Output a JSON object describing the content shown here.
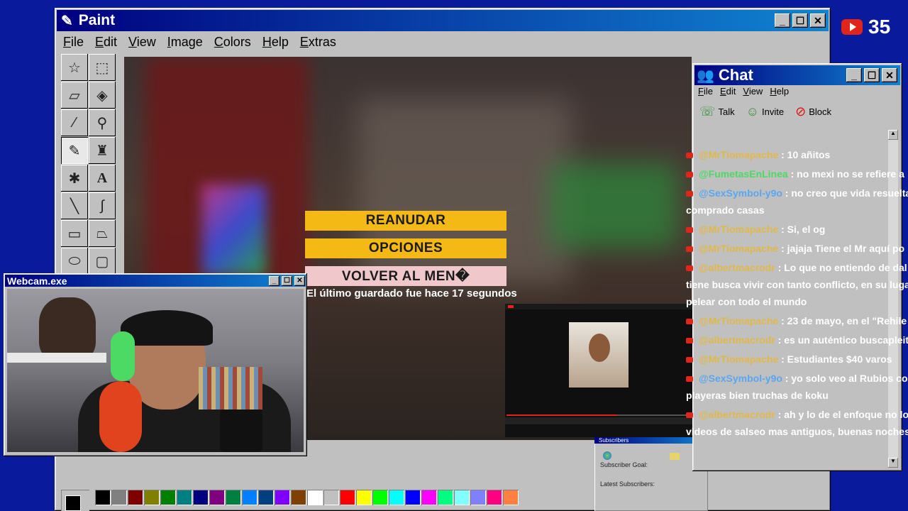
{
  "youtube_counter": {
    "count": "35"
  },
  "paint": {
    "title": "Paint",
    "menu": [
      "File",
      "Edit",
      "View",
      "Image",
      "Colors",
      "Help",
      "Extras"
    ],
    "tools": [
      "free-select-icon",
      "rect-select-icon",
      "eraser-icon",
      "fill-bucket-icon",
      "color-picker-icon",
      "magnifier-icon",
      "pencil-icon",
      "brush-icon",
      "airbrush-icon",
      "text-icon",
      "line-icon",
      "curve-icon",
      "rectangle-icon",
      "polygon-icon",
      "ellipse-icon",
      "rounded-rect-icon"
    ],
    "palette": [
      "#000000",
      "#808080",
      "#800000",
      "#808000",
      "#008000",
      "#008080",
      "#000080",
      "#800080",
      "#008040",
      "#0080ff",
      "#004080",
      "#8000ff",
      "#804000",
      "#ffffff",
      "#c0c0c0",
      "#ff0000",
      "#ffff00",
      "#00ff00",
      "#00ffff",
      "#0000ff",
      "#ff00ff",
      "#00ff80",
      "#80ffff",
      "#8080ff",
      "#ff0080",
      "#ff8040"
    ]
  },
  "game_menu": {
    "resume": "REANUDAR",
    "options": "OPCIONES",
    "main_menu": "VOLVER AL MEN�",
    "save_note": "El último guardado fue hace 17 segundos"
  },
  "webcam": {
    "title": "Webcam.exe"
  },
  "chat": {
    "title": "Chat",
    "menu": [
      "File",
      "Edit",
      "View",
      "Help"
    ],
    "toolbar": {
      "talk": "Talk",
      "invite": "Invite",
      "block": "Block"
    },
    "messages": [
      {
        "user": "@MrTiomapache",
        "color": "#e0b84a",
        "text": "10 añitos"
      },
      {
        "user": "@FumetasEnLinea",
        "color": "#4cd964",
        "text": "no mexi no se refiere a"
      },
      {
        "user": "@SexSymbol-y9o",
        "color": "#5aa7f0",
        "text": "no creo que vida resuelta",
        "cont": "comprado casas"
      },
      {
        "user": "@MrTiomapache",
        "color": "#e0b84a",
        "text": "Si, el og"
      },
      {
        "user": "@MrTiomapache",
        "color": "#e0b84a",
        "text": "jajaja Tiene el Mr aquí po"
      },
      {
        "user": "@albertmacrodr",
        "color": "#e0b84a",
        "text": "Lo que no entiendo de dal",
        "cont": "tiene busca vivir con tanto conflicto, en su lugar",
        "cont2": "pelear con todo el mundo"
      },
      {
        "user": "@MrTiomapache",
        "color": "#e0b84a",
        "text": "23 de mayo, en el \"Rehile"
      },
      {
        "user": "@albertmacrodr",
        "color": "#e0b84a",
        "text": "es un auténtico buscapleit"
      },
      {
        "user": "@MrTiomapache",
        "color": "#e0b84a",
        "text": "Estudiantes $40 varos"
      },
      {
        "user": "@SexSymbol-y9o",
        "color": "#5aa7f0",
        "text": "yo solo veo al Rubios co",
        "cont": "playeras bien truchas de koku"
      },
      {
        "user": "@albertmacrodr",
        "color": "#e0b84a",
        "text": "ah y lo de el enfoque no lo",
        "cont": "videos de salseo mas antiguos, buenas noches"
      }
    ]
  },
  "subscribers": {
    "title": "Subscribers",
    "goal": "Subscriber Goal:",
    "latest": "Latest Subscribers:"
  }
}
